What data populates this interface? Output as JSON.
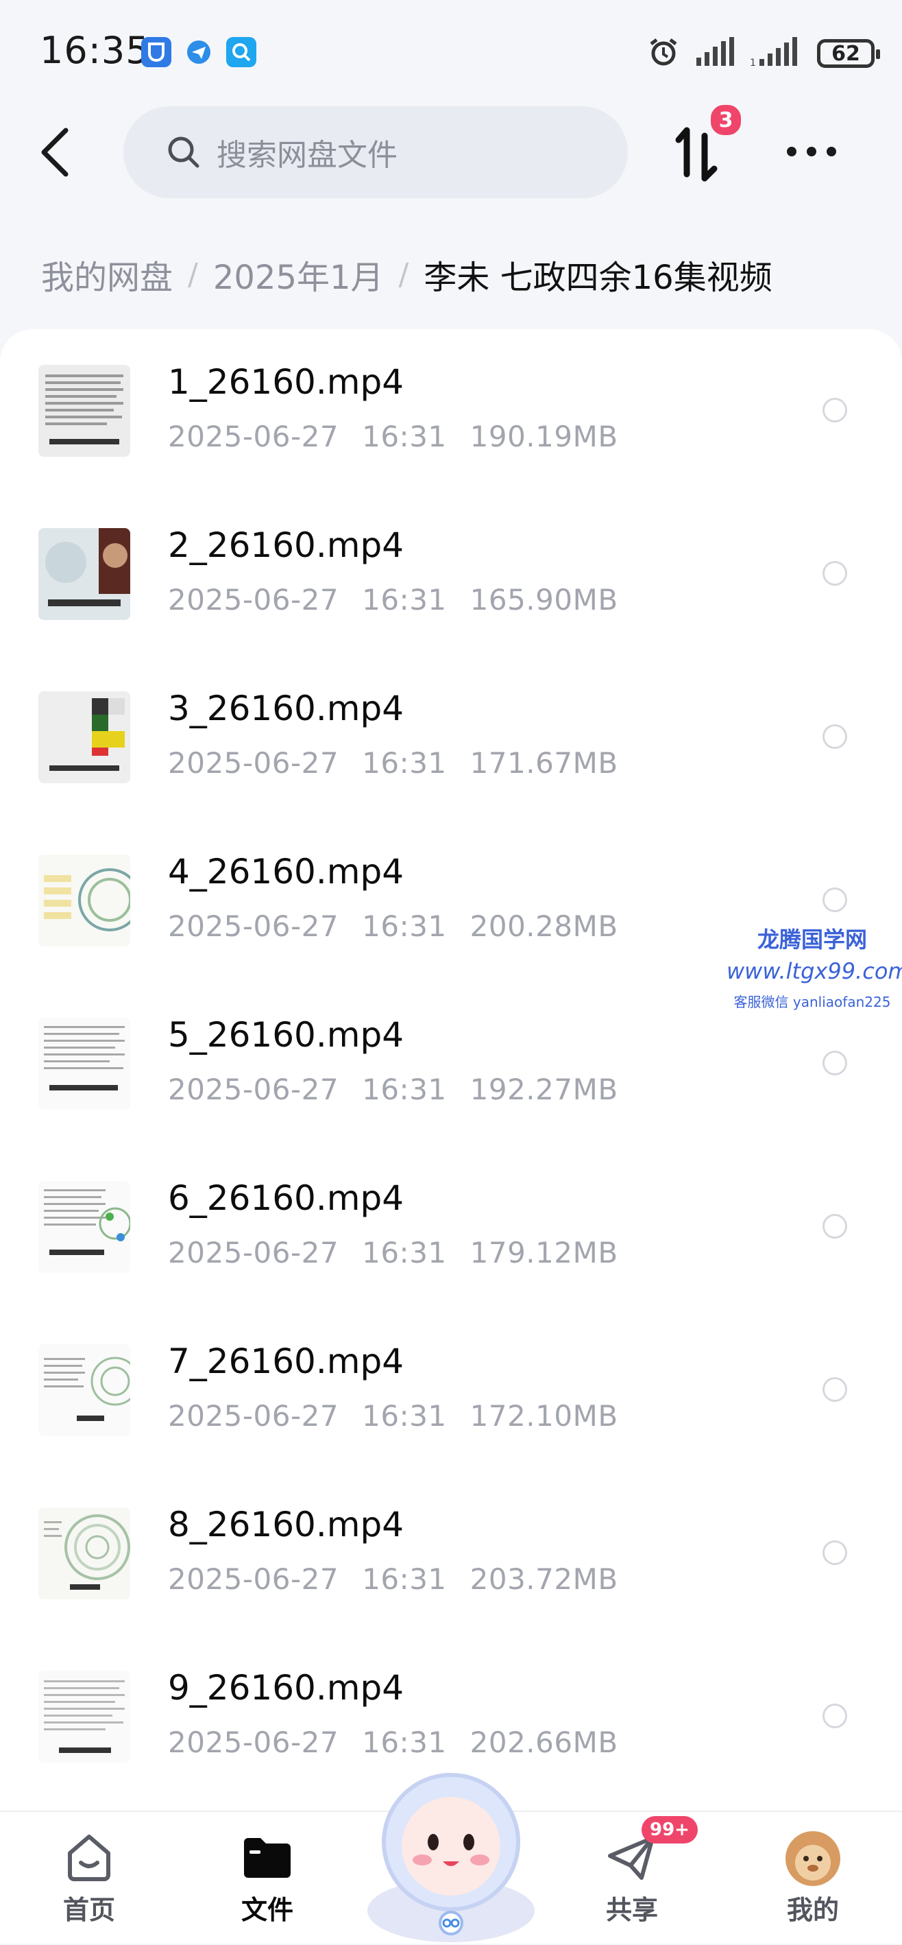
{
  "status_bar": {
    "time": "16:35",
    "battery": "62",
    "app_icons": [
      "shield-app-icon",
      "bird-app-icon",
      "search-app-icon"
    ]
  },
  "header": {
    "search_placeholder": "搜索网盘文件",
    "transfer_badge": "3"
  },
  "breadcrumb": {
    "items": [
      "我的网盘",
      "2025年1月"
    ],
    "separator": "/",
    "current": "李未  七政四余16集视频"
  },
  "files": [
    {
      "name": "1_26160.mp4",
      "date": "2025-06-27",
      "time": "16:31",
      "size": "190.19MB"
    },
    {
      "name": "2_26160.mp4",
      "date": "2025-06-27",
      "time": "16:31",
      "size": "165.90MB"
    },
    {
      "name": "3_26160.mp4",
      "date": "2025-06-27",
      "time": "16:31",
      "size": "171.67MB"
    },
    {
      "name": "4_26160.mp4",
      "date": "2025-06-27",
      "time": "16:31",
      "size": "200.28MB"
    },
    {
      "name": "5_26160.mp4",
      "date": "2025-06-27",
      "time": "16:31",
      "size": "192.27MB"
    },
    {
      "name": "6_26160.mp4",
      "date": "2025-06-27",
      "time": "16:31",
      "size": "179.12MB"
    },
    {
      "name": "7_26160.mp4",
      "date": "2025-06-27",
      "time": "16:31",
      "size": "172.10MB"
    },
    {
      "name": "8_26160.mp4",
      "date": "2025-06-27",
      "time": "16:31",
      "size": "203.72MB"
    },
    {
      "name": "9_26160.mp4",
      "date": "2025-06-27",
      "time": "16:31",
      "size": "202.66MB"
    }
  ],
  "watermark": {
    "line1": "龙腾国学网",
    "line2": "www.ltgx99.com",
    "line3": "客服微信 yanliaofan225"
  },
  "tab_bar": {
    "tabs": [
      {
        "label": "首页",
        "icon": "home-icon"
      },
      {
        "label": "文件",
        "icon": "folder-icon"
      },
      {
        "label": "共享",
        "icon": "share-icon"
      },
      {
        "label": "我的",
        "icon": "avatar-icon"
      }
    ],
    "active": "文件",
    "share_badge": "99+"
  },
  "colors": {
    "accent_badge": "#f0456b",
    "watermark": "#3b62d8",
    "meta_text": "#a2a5ad"
  }
}
